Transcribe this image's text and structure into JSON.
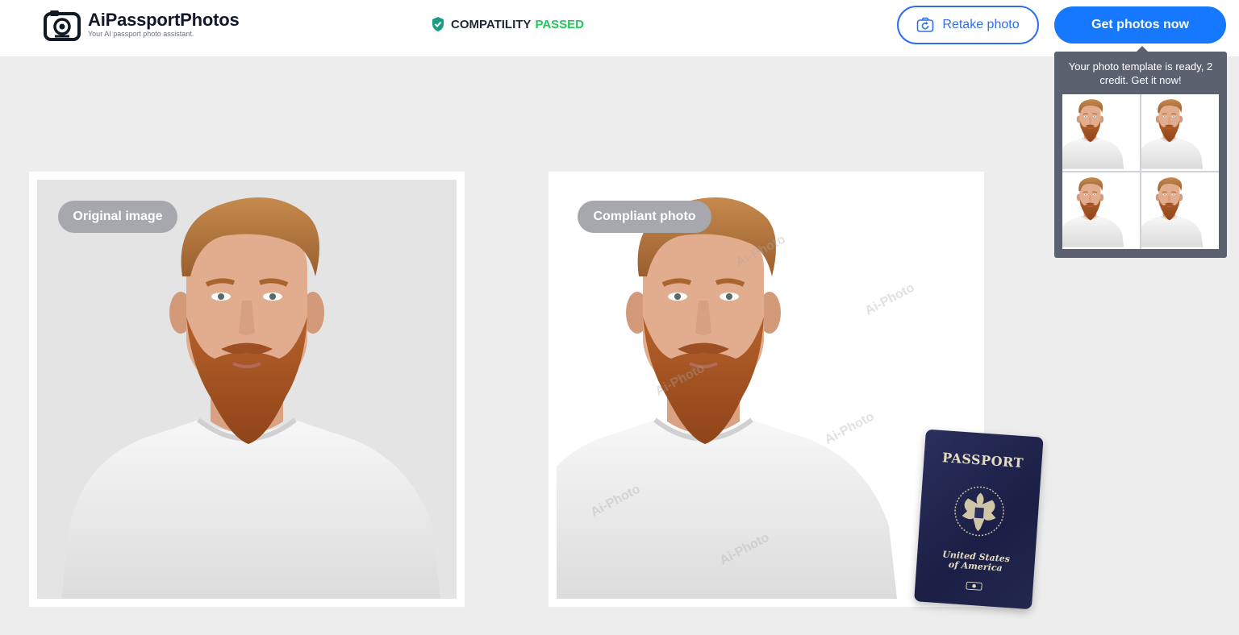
{
  "header": {
    "logo_title": "AiPassportPhotos",
    "logo_subtitle": "Your AI passport photo assistant.",
    "compat_label": "COMPATILITY",
    "compat_status": "PASSED",
    "retake_label": "Retake photo",
    "get_label": "Get photos now"
  },
  "tooltip": {
    "text": "Your photo template is ready, 2 credit. Get it now!"
  },
  "original": {
    "label": "Original image"
  },
  "compliant": {
    "label": "Compliant photo",
    "watermark": "Ai-Photo"
  },
  "passport": {
    "title": "PASSPORT",
    "country_line1": "United States",
    "country_line2": "of America"
  },
  "colors": {
    "accent": "#1677ff",
    "outline_accent": "#2f6fed",
    "passed": "#22c55e",
    "tooltip_bg": "#5c6170",
    "pill_bg": "#a6a8ad",
    "page_bg": "#ededed"
  },
  "icons": {
    "logo": "camera-frame-icon",
    "compat": "shield-check-icon",
    "retake": "camera-rotate-icon"
  }
}
